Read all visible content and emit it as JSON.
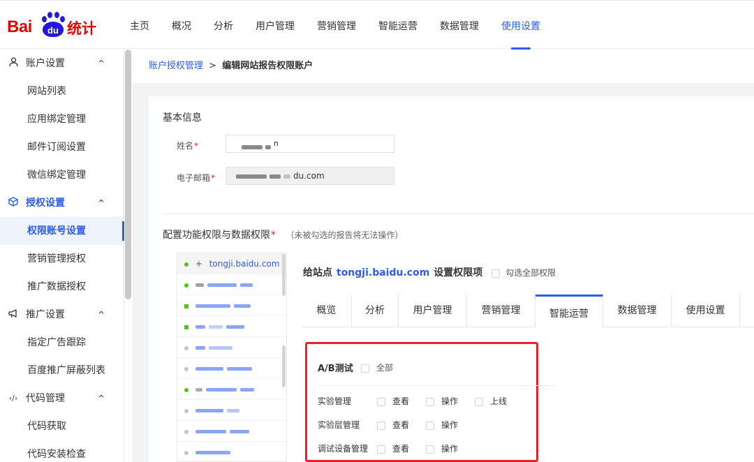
{
  "logo": {
    "bai": "Bai",
    "du": "du",
    "tongji": "统计"
  },
  "topnav": {
    "items": [
      "主页",
      "概况",
      "分析",
      "用户管理",
      "营销管理",
      "智能运营",
      "数据管理",
      "使用设置"
    ],
    "active": "使用设置"
  },
  "sidebar": {
    "groups": [
      {
        "label": "账户设置",
        "icon": "user-icon",
        "items": [
          "网站列表",
          "应用绑定管理",
          "邮件订阅设置",
          "微信绑定管理"
        ]
      },
      {
        "label": "授权设置",
        "icon": "cube-icon",
        "items": [
          "权限账号设置",
          "营销管理授权",
          "推广数据授权"
        ]
      },
      {
        "label": "推广设置",
        "icon": "megaphone-icon",
        "items": [
          "指定广告跟踪",
          "百度推广屏蔽列表"
        ]
      },
      {
        "label": "代码管理",
        "icon": "code-icon",
        "items": [
          "代码获取",
          "代码安装检查"
        ]
      }
    ],
    "active_group": "授权设置",
    "active_item": "权限账号设置",
    "chevron": "^",
    "code_glyph": "‹/›"
  },
  "breadcrumb": {
    "parent": "账户授权管理",
    "separator": ">",
    "current": "编辑网站报告权限账户"
  },
  "basic_info": {
    "title": "基本信息",
    "name_label": "姓名",
    "name_value_suffix": "n",
    "email_label": "电子邮箱",
    "email_value_suffix": "du.com",
    "required_mark": "*"
  },
  "permissions": {
    "title": "配置功能权限与数据权限",
    "hint": "（未被勾选的报告将无法操作）",
    "site_list": [
      {
        "name": "tongji.baidu.com",
        "status": "green",
        "expandable": true
      }
    ],
    "panel": {
      "prefix": "给站点",
      "site": "tongji.baidu.com",
      "suffix": "设置权限项",
      "check_all": "勾选全部权限"
    },
    "tabs": [
      "概览",
      "分析",
      "用户管理",
      "营销管理",
      "智能运营",
      "数据管理",
      "使用设置"
    ],
    "active_tab": "智能运营",
    "section": {
      "title": "A/B测试",
      "all_label": "全部",
      "rows": [
        {
          "label": "实验管理",
          "options": [
            "查看",
            "操作",
            "上线"
          ]
        },
        {
          "label": "实验层管理",
          "options": [
            "查看",
            "操作"
          ]
        },
        {
          "label": "调试设备管理",
          "options": [
            "查看",
            "操作"
          ]
        }
      ]
    }
  },
  "colors": {
    "brand_red": "#e10601",
    "brand_blue": "#2319dc",
    "accent": "#2e5ce6",
    "highlight_box": "#e3252a"
  }
}
